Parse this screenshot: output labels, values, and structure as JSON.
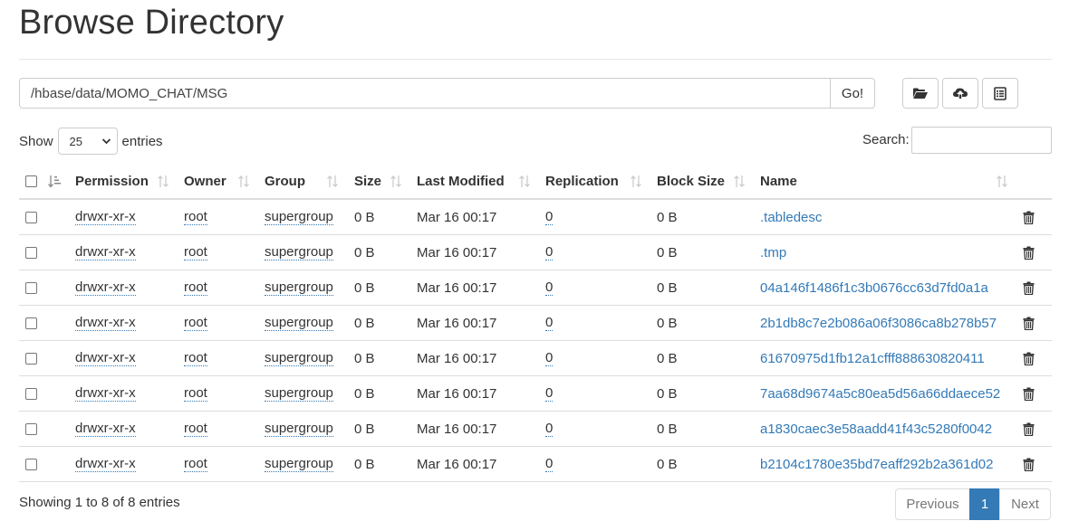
{
  "page": {
    "title": "Browse Directory"
  },
  "path_bar": {
    "value": "/hbase/data/MOMO_CHAT/MSG",
    "go_label": "Go!"
  },
  "toolbar": {
    "icons": [
      "folder-open-icon",
      "upload-cloud-icon",
      "list-alt-icon"
    ]
  },
  "table_controls": {
    "show_label": "Show",
    "page_length": "25",
    "entries_label": "entries",
    "search_label": "Search:",
    "search_value": ""
  },
  "table": {
    "columns": [
      "Permission",
      "Owner",
      "Group",
      "Size",
      "Last Modified",
      "Replication",
      "Block Size",
      "Name"
    ],
    "rows": [
      {
        "permission": "drwxr-xr-x",
        "owner": "root",
        "group": "supergroup",
        "size": "0 B",
        "modified": "Mar 16 00:17",
        "replication": "0",
        "block_size": "0 B",
        "name": ".tabledesc"
      },
      {
        "permission": "drwxr-xr-x",
        "owner": "root",
        "group": "supergroup",
        "size": "0 B",
        "modified": "Mar 16 00:17",
        "replication": "0",
        "block_size": "0 B",
        "name": ".tmp"
      },
      {
        "permission": "drwxr-xr-x",
        "owner": "root",
        "group": "supergroup",
        "size": "0 B",
        "modified": "Mar 16 00:17",
        "replication": "0",
        "block_size": "0 B",
        "name": "04a146f1486f1c3b0676cc63d7fd0a1a"
      },
      {
        "permission": "drwxr-xr-x",
        "owner": "root",
        "group": "supergroup",
        "size": "0 B",
        "modified": "Mar 16 00:17",
        "replication": "0",
        "block_size": "0 B",
        "name": "2b1db8c7e2b086a06f3086ca8b278b57"
      },
      {
        "permission": "drwxr-xr-x",
        "owner": "root",
        "group": "supergroup",
        "size": "0 B",
        "modified": "Mar 16 00:17",
        "replication": "0",
        "block_size": "0 B",
        "name": "61670975d1fb12a1cfff888630820411"
      },
      {
        "permission": "drwxr-xr-x",
        "owner": "root",
        "group": "supergroup",
        "size": "0 B",
        "modified": "Mar 16 00:17",
        "replication": "0",
        "block_size": "0 B",
        "name": "7aa68d9674a5c80ea5d56a66ddaece52"
      },
      {
        "permission": "drwxr-xr-x",
        "owner": "root",
        "group": "supergroup",
        "size": "0 B",
        "modified": "Mar 16 00:17",
        "replication": "0",
        "block_size": "0 B",
        "name": "a1830caec3e58aadd41f43c5280f0042"
      },
      {
        "permission": "drwxr-xr-x",
        "owner": "root",
        "group": "supergroup",
        "size": "0 B",
        "modified": "Mar 16 00:17",
        "replication": "0",
        "block_size": "0 B",
        "name": "b2104c1780e35bd7eaff292b2a361d02"
      }
    ]
  },
  "footer": {
    "info": "Showing 1 to 8 of 8 entries",
    "previous_label": "Previous",
    "current_page": "1",
    "next_label": "Next"
  },
  "colors": {
    "link": "#337ab7",
    "active_page": "#337ab7",
    "border": "#dddddd"
  }
}
